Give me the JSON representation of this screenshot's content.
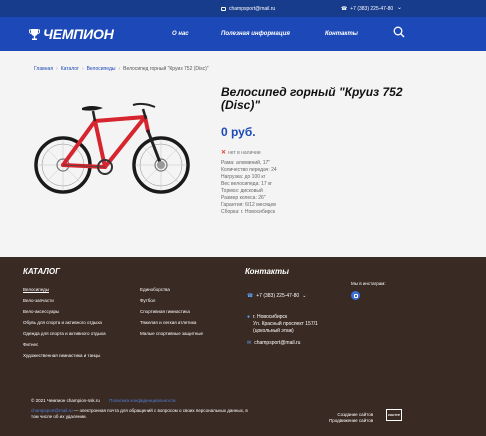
{
  "topbar": {
    "email": "champsport@mail.ru",
    "phone": "+7 (383) 225-47-80"
  },
  "header": {
    "brand": "ЧЕМПИОН",
    "nav": [
      "О нас",
      "Полезная информация",
      "Контакты"
    ]
  },
  "breadcrumbs": [
    "Главная",
    "Каталог",
    "Велосипеды",
    "Велосипед горный \"Круиз 752 (Disc)\""
  ],
  "product": {
    "title": "Велосипед горный \"Круиз 752 (Disc)\"",
    "price": "0 руб.",
    "stock": "нет в наличии",
    "specs": [
      "Рама: алюминий, 17\"",
      "Количество передач: 24",
      "Нагрузка: до 100 кг",
      "Вес велосипеда: 17 кг",
      "Тормоз: дисковый",
      "Размер колеса: 26\"",
      "Гарантия: 6/12 месяцев",
      "Сборка: г. Новосибирск"
    ]
  },
  "footer": {
    "catalog_title": "КАТАЛОГ",
    "catalog_col1": [
      "Велосипеды",
      "Вело-запчасти",
      "Вело-аксессуары",
      "Обувь для спорта и активного отдыха",
      "Одежда для спорта и активного отдыха",
      "Фитнес",
      "Художественная гимнастика и танцы"
    ],
    "catalog_col2": [
      "Единоборства",
      "Футбол",
      "Спортивная гимнастика",
      "Тяжелая и легкая атлетика",
      "Малые спортивные защитные"
    ],
    "contacts_title": "Контакты",
    "phone": "+7 (383) 225-47-80",
    "address_lines": [
      "г. Новосибирск",
      "Ул. Красный проспект 157/1",
      "(цокольный этаж)"
    ],
    "email": "champsport@mail.ru",
    "instagram_label": "Мы в инстаграм:",
    "copyright": "© 2021 Чемпион champion-nsk.ru",
    "policy": "Политика конфиденциальности",
    "note_email": "champsport@mail.ru",
    "note_text": " — электронная почта для обращений с вопросом о своих персональных данных, в том числе об их удалении.",
    "made_lines": [
      "Создание сайтов",
      "Продвижение сайтов"
    ],
    "kontur": "КОНТУР"
  },
  "colors": {
    "topbar": "#183c8c",
    "header": "#1d48b8",
    "footer": "#3a2a24",
    "bike_frame": "#d6252e"
  }
}
